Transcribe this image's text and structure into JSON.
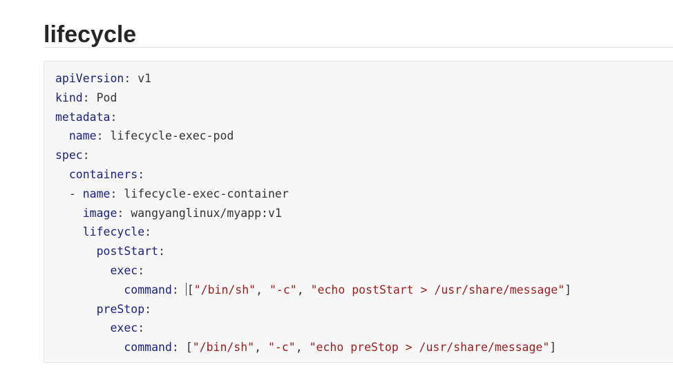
{
  "heading": "lifecycle",
  "code": {
    "language": "yaml",
    "lines": [
      {
        "indent": "",
        "dash": "",
        "key": "apiVersion",
        "value": "v1"
      },
      {
        "indent": "",
        "dash": "",
        "key": "kind",
        "value": "Pod"
      },
      {
        "indent": "",
        "dash": "",
        "key": "metadata",
        "value": ""
      },
      {
        "indent": "  ",
        "dash": "",
        "key": "name",
        "value": "lifecycle-exec-pod"
      },
      {
        "indent": "",
        "dash": "",
        "key": "spec",
        "value": ""
      },
      {
        "indent": "  ",
        "dash": "",
        "key": "containers",
        "value": ""
      },
      {
        "indent": "  ",
        "dash": "- ",
        "key": "name",
        "value": "lifecycle-exec-container"
      },
      {
        "indent": "    ",
        "dash": "",
        "key": "image",
        "value": "wangyanglinux/myapp:v1"
      },
      {
        "indent": "    ",
        "dash": "",
        "key": "lifecycle",
        "value": ""
      },
      {
        "indent": "      ",
        "dash": "",
        "key": "postStart",
        "value": ""
      },
      {
        "indent": "        ",
        "dash": "",
        "key": "exec",
        "value": ""
      },
      {
        "indent": "          ",
        "dash": "",
        "key": "command",
        "caret": true,
        "list": [
          "\"/bin/sh\"",
          "\"-c\"",
          "\"echo postStart > /usr/share/message\""
        ]
      },
      {
        "indent": "      ",
        "dash": "",
        "key": "preStop",
        "value": ""
      },
      {
        "indent": "        ",
        "dash": "",
        "key": "exec",
        "value": ""
      },
      {
        "indent": "          ",
        "dash": "",
        "key": "command",
        "list": [
          "\"/bin/sh\"",
          "\"-c\"",
          "\"echo preStop > /usr/share/message\""
        ]
      }
    ]
  },
  "colors": {
    "key": "#1c1f7e",
    "string": "#9b1c1c",
    "text": "#333333",
    "code_background": "#f7f7f7"
  }
}
